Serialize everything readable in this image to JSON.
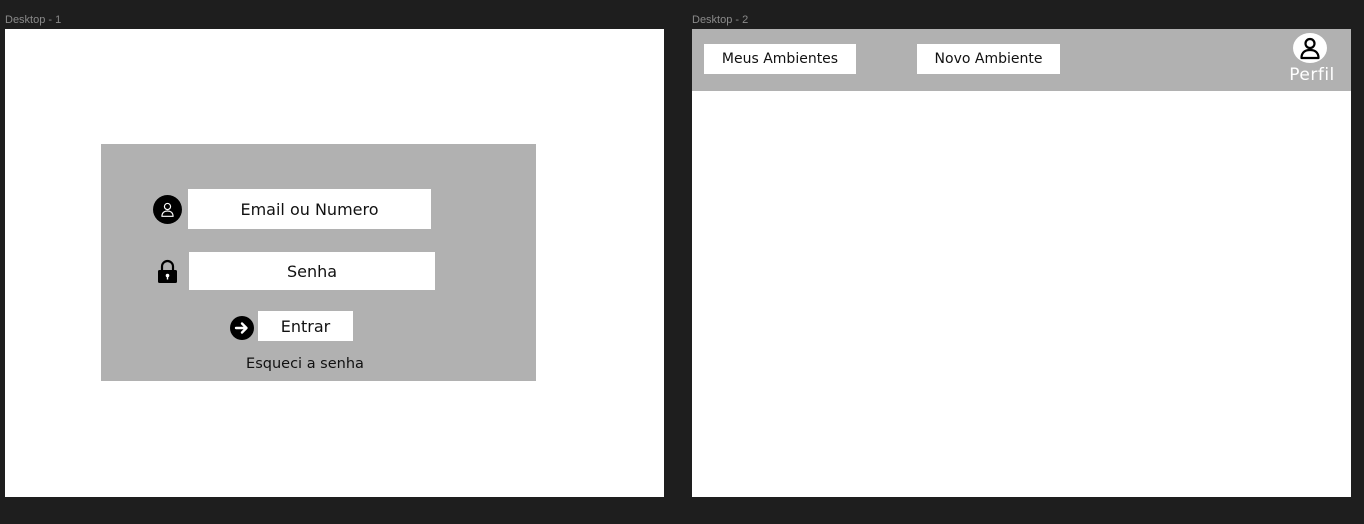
{
  "frames": [
    {
      "label": "Desktop - 1"
    },
    {
      "label": "Desktop - 2"
    }
  ],
  "login": {
    "email_placeholder": "Email ou Numero",
    "password_placeholder": "Senha",
    "submit_label": "Entrar",
    "forgot_label": "Esqueci a senha",
    "icons": [
      "user-icon",
      "lock-icon",
      "arrow-right-icon"
    ]
  },
  "nav": {
    "meus_ambientes": "Meus Ambientes",
    "novo_ambiente": "Novo Ambiente",
    "profile_label": "Perfil",
    "profile_icon": "user-icon"
  },
  "colors": {
    "canvas": "#1e1e1e",
    "frame": "#ffffff",
    "panel": "#b1b1b1"
  }
}
